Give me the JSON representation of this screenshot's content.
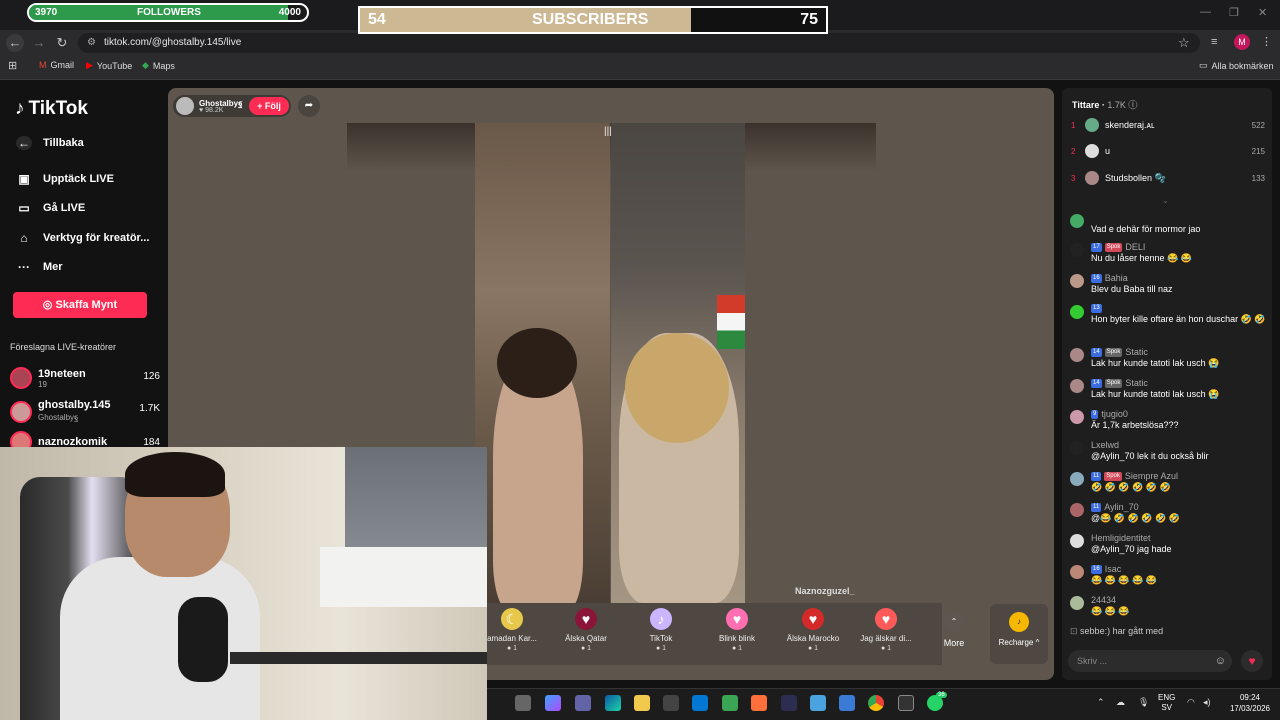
{
  "overlay": {
    "followers": {
      "label": "FOLLOWERS",
      "current": "3970",
      "goal": "4000",
      "progress": 0.93
    },
    "subscribers": {
      "label": "SUBSCRIBERS",
      "current": "54",
      "goal": "75",
      "progress": 0.71
    }
  },
  "browser": {
    "url": "tiktok.com/@ghostalby.145/live",
    "bookmarks": [
      "Gmail",
      "YouTube",
      "Maps"
    ],
    "all_bookmarks": "Alla bokmärken",
    "profile_initial": "M"
  },
  "sidebar": {
    "logo": "TikTok",
    "back": "Tillbaka",
    "items": [
      {
        "label": "Upptäck LIVE",
        "icon": "calendar-live-icon"
      },
      {
        "label": "Gå LIVE",
        "icon": "video-camera-icon"
      },
      {
        "label": "Verktyg för kreatör...",
        "icon": "creator-tools-icon"
      },
      {
        "label": "Mer",
        "icon": "more-dots-icon"
      }
    ],
    "coins_button": "Skaffa Mynt",
    "suggested_heading": "Föreslagna LIVE-kreatörer",
    "suggested": [
      {
        "name": "19neteen",
        "sub": "19",
        "count": "126"
      },
      {
        "name": "ghostalby.145",
        "sub": "Ghostalbyฐ",
        "count": "1.7K"
      },
      {
        "name": "naznozkomik",
        "sub": "",
        "count": "184"
      }
    ]
  },
  "stream": {
    "host_name": "Ghostalbyฐ",
    "host_likes": "98.2K",
    "follow_label": "+ Följ",
    "guest_label": "Naznozguzel_",
    "gifts": [
      {
        "name": "amadan Kar...",
        "price": "1",
        "icon": "ramadan-gift-icon",
        "color": "#e8c84a"
      },
      {
        "name": "Älska Qatar",
        "price": "1",
        "icon": "qatar-heart-icon",
        "color": "#8a1538"
      },
      {
        "name": "TikTok",
        "price": "1",
        "icon": "tiktok-gift-icon",
        "color": "#c9b6ff"
      },
      {
        "name": "Blink blink",
        "price": "1",
        "icon": "blink-heart-icon",
        "color": "#ff6fb1"
      },
      {
        "name": "Älska Marocko",
        "price": "1",
        "icon": "morocco-heart-icon",
        "color": "#d42a2a"
      },
      {
        "name": "Jag älskar di...",
        "price": "1",
        "icon": "love-heart-icon",
        "color": "#ff5a5a"
      }
    ],
    "more_label": "More",
    "recharge_label": "Recharge ^"
  },
  "viewers": {
    "heading": "Tittare",
    "count": "1.7K",
    "top": [
      {
        "rank": "1",
        "name": "skenderaj.ᴀʟ",
        "score": "522"
      },
      {
        "rank": "2",
        "name": "u",
        "score": "215"
      },
      {
        "rank": "3",
        "name": "Studsbollen 🫧",
        "score": "133"
      }
    ]
  },
  "chat": [
    {
      "user": "",
      "badges": [],
      "text": "Vad e dehär för mormor jao"
    },
    {
      "user": "DELI",
      "badges": [
        {
          "t": "17",
          "c": "b"
        },
        {
          "t": "Spok",
          "c": "r"
        }
      ],
      "text": "Nu du låser henne 😂 😂"
    },
    {
      "user": "Bahia",
      "badges": [
        {
          "t": "16",
          "c": "b"
        }
      ],
      "text": "Blev du Baba till naz"
    },
    {
      "user": "",
      "badges": [
        {
          "t": "13",
          "c": "b"
        }
      ],
      "text": "Hon byter kille oftare än hon duschar 🤣 🤣"
    },
    {
      "user": "Static",
      "badges": [
        {
          "t": "14",
          "c": "b"
        },
        {
          "t": "Spok",
          "c": "g"
        }
      ],
      "text": "Lak hur kunde tatoti lak usch 😭"
    },
    {
      "user": "Static",
      "badges": [
        {
          "t": "14",
          "c": "b"
        },
        {
          "t": "Spok",
          "c": "g"
        }
      ],
      "text": "Lak hur kunde tatoti lak usch 😭"
    },
    {
      "user": "tjugio0",
      "badges": [
        {
          "t": "9",
          "c": "b"
        }
      ],
      "text": "Är 1,7k arbetslösa???"
    },
    {
      "user": "Lxelwd",
      "badges": [],
      "text": "@Aylin_70 lek it du också blir"
    },
    {
      "user": "Siempre Azul",
      "badges": [
        {
          "t": "11",
          "c": "b"
        },
        {
          "t": "Spok",
          "c": "r"
        }
      ],
      "text": "🤣 🤣 🤣 🤣 🤣 🤣"
    },
    {
      "user": "Aylin_70",
      "badges": [
        {
          "t": "11",
          "c": "b"
        }
      ],
      "text": "@😂 🤣 🤣 🤣 🤣 🤣"
    },
    {
      "user": "Hemligidentitet",
      "badges": [],
      "text": "@Aylin_70 jag hade"
    },
    {
      "user": "Isac",
      "badges": [
        {
          "t": "16",
          "c": "b"
        }
      ],
      "text": "😂 😂 😂 😂 😂"
    },
    {
      "user": "24434",
      "badges": [],
      "text": "😂 😂 😂"
    }
  ],
  "system_message": "sebbe:) har gått med",
  "chat_placeholder": "Skriv ...",
  "taskbar": {
    "lang": "ENG",
    "region": "SV",
    "time": "09:24",
    "date": "17/03/2026",
    "badge": "36"
  },
  "colors": {
    "accent": "#fe2c55",
    "follower_fill": "#2c9a4a",
    "sub_fill": "#cdb894"
  }
}
